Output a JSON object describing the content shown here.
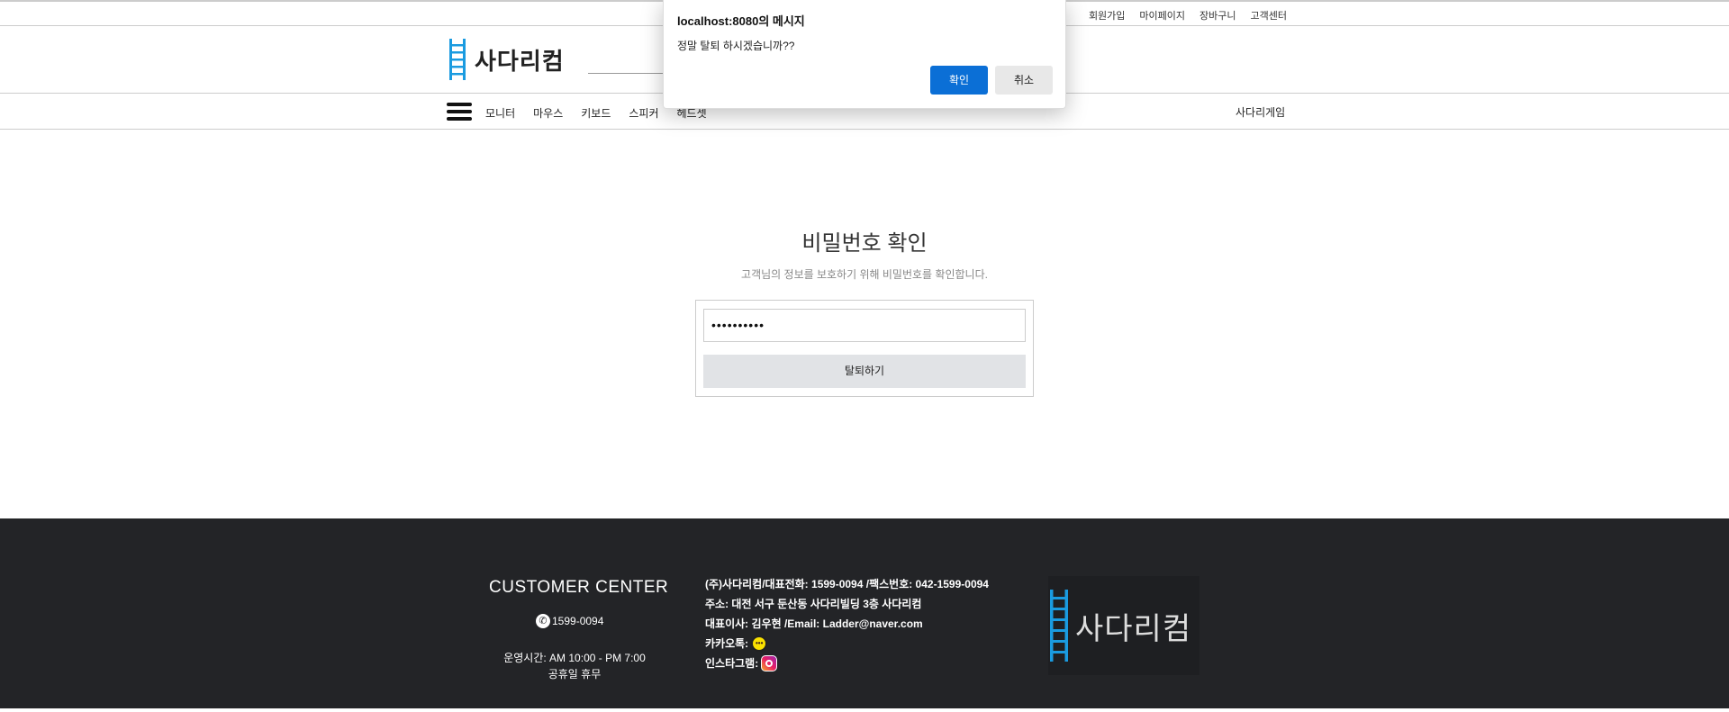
{
  "colors": {
    "accent": "#0b6fd6",
    "ladder": "#1a9be0",
    "footer_bg": "#232427",
    "button_bg": "#e1e3e6"
  },
  "top_links": [
    "회원가입",
    "마이페이지",
    "장바구니",
    "고객센터"
  ],
  "logo": {
    "text": "사다리컴",
    "icon": "ladder-icon"
  },
  "nav": {
    "menu_icon": "hamburger-icon",
    "items": [
      "모니터",
      "마우스",
      "키보드",
      "스피커",
      "헤드셋"
    ],
    "right_link": "사다리게임"
  },
  "main": {
    "title": "비밀번호 확인",
    "subtitle": "고객님의 정보를 보호하기 위해 비밀번호를 확인합니다.",
    "password_value": "••••••••••",
    "withdraw_button": "탈퇴하기"
  },
  "footer": {
    "cc_title": "CUSTOMER CENTER",
    "cc_phone": "1599-0094",
    "cc_hours": "운영시간: AM 10:00 - PM 7:00",
    "cc_holiday": "공휴일 휴무",
    "info_line1": "(주)사다리컴/대표전화: 1599-0094 /팩스번호: 042-1599-0094",
    "info_line2": "주소: 대전 서구 둔산동 사다리빌딩 3층 사다리컴",
    "info_line3": "대표이사: 김우현 /Email: Ladder@naver.com",
    "kakao_label": "카카오톡:",
    "instagram_label": "인스타그램:",
    "logo_text": "사다리컴"
  },
  "dialog": {
    "title": "localhost:8080의 메시지",
    "message": "정말 탈퇴 하시겠습니까??",
    "ok_label": "확인",
    "cancel_label": "취소"
  }
}
